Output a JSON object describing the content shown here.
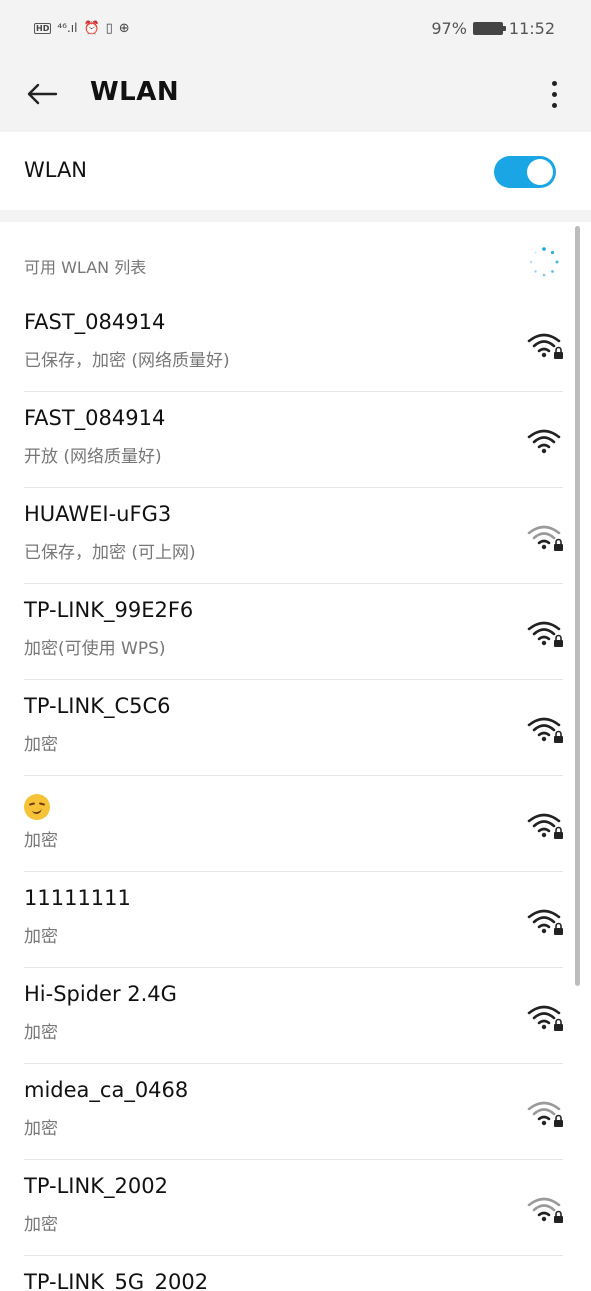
{
  "status_bar": {
    "left_text": "HD ⁴⁶.ıl ⏰ 📳 ⊕",
    "battery_pct": "97%",
    "time": "11:52"
  },
  "app_bar": {
    "title": "WLAN",
    "back_icon": "arrow-left-icon",
    "more_icon": "more-vertical-icon"
  },
  "wlan_toggle": {
    "label": "WLAN",
    "on": true,
    "accent_color": "#1aa6e4"
  },
  "network_section": {
    "header": "可用 WLAN 列表",
    "loading_icon": "spinner-icon"
  },
  "networks": [
    {
      "ssid": "FAST_084914",
      "desc": "已保存，加密 (网络质量好)",
      "secured": true,
      "strong": true
    },
    {
      "ssid": "FAST_084914",
      "desc": "开放 (网络质量好)",
      "secured": false,
      "strong": true
    },
    {
      "ssid": "HUAWEI-uFG3",
      "desc": "已保存，加密 (可上网)",
      "secured": true,
      "strong": false
    },
    {
      "ssid": "TP-LINK_99E2F6",
      "desc": "加密(可使用 WPS)",
      "secured": true,
      "strong": true
    },
    {
      "ssid": "TP-LINK_C5C6",
      "desc": "加密",
      "secured": true,
      "strong": true
    },
    {
      "ssid": "",
      "desc": "加密",
      "secured": true,
      "strong": true,
      "emoji_icon": "smirk-emoji-icon"
    },
    {
      "ssid": "11111111",
      "desc": "加密",
      "secured": true,
      "strong": true
    },
    {
      "ssid": "Hi-Spider 2.4G",
      "desc": "加密",
      "secured": true,
      "strong": true
    },
    {
      "ssid": "midea_ca_0468",
      "desc": "加密",
      "secured": true,
      "strong": false
    },
    {
      "ssid": "TP-LINK_2002",
      "desc": "加密",
      "secured": true,
      "strong": false
    },
    {
      "ssid": "TP-LINK_5G_2002",
      "desc": "",
      "secured": true,
      "strong": false
    }
  ]
}
